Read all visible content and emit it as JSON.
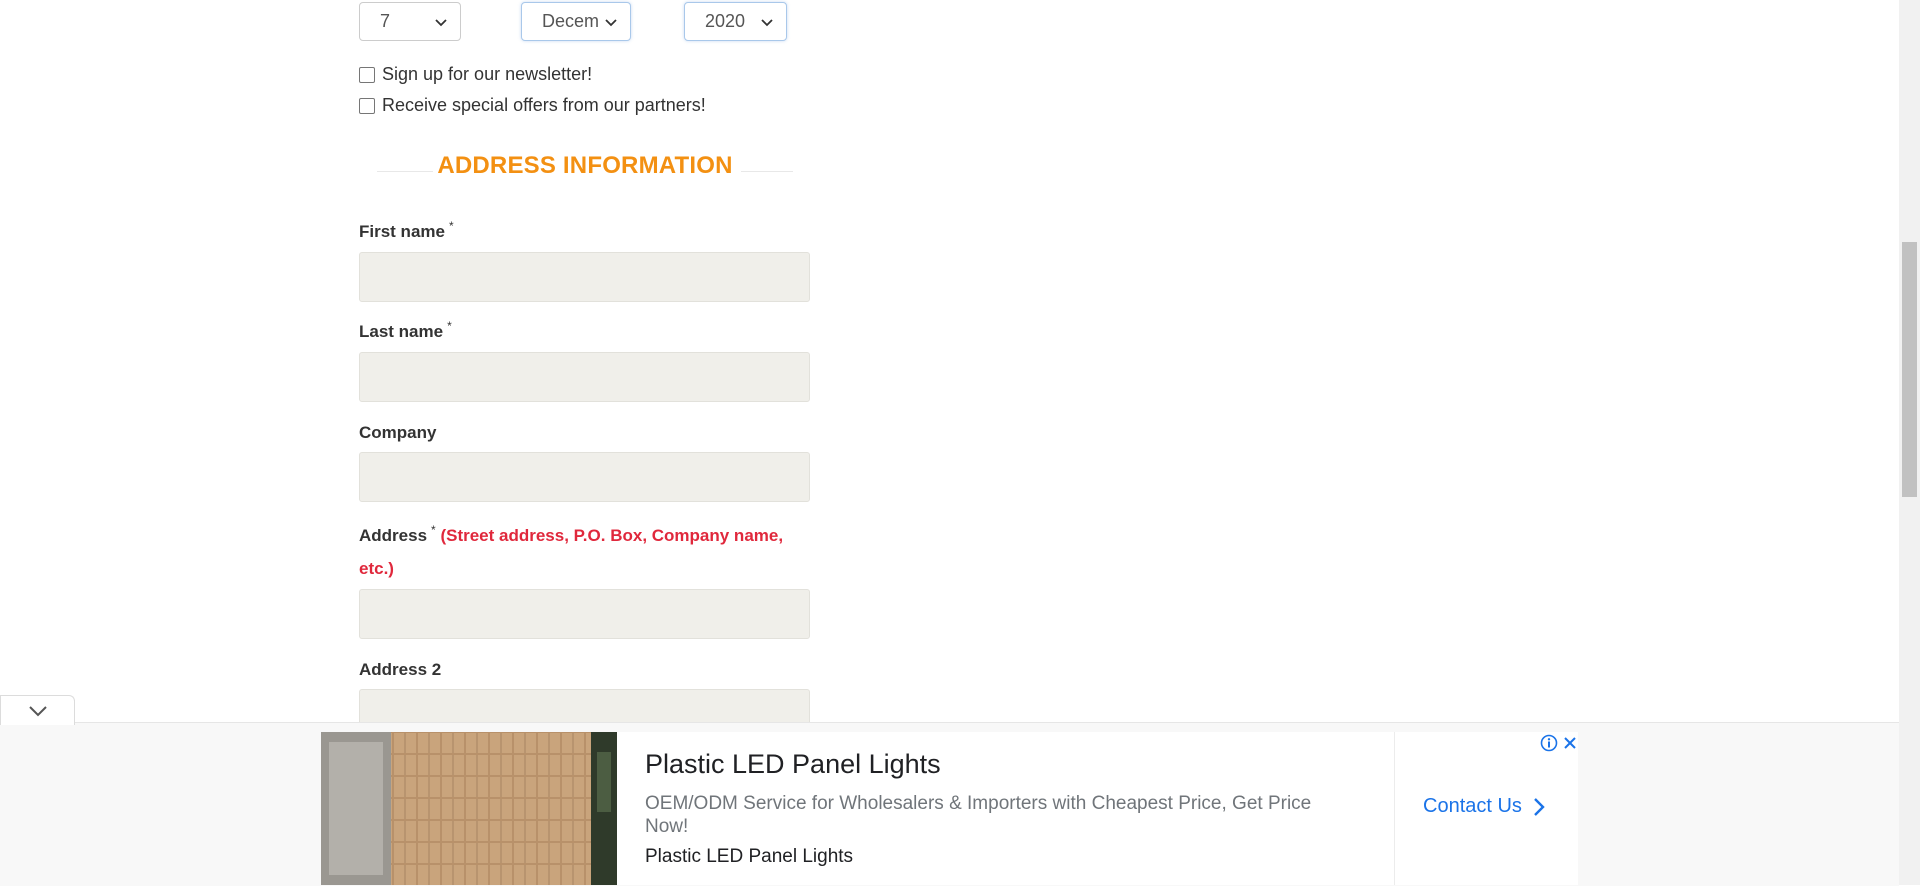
{
  "dob": {
    "day": "7",
    "month": "Decem",
    "year": "2020"
  },
  "checkboxes": {
    "newsletter": "Sign up for our newsletter!",
    "offers": "Receive special offers from our partners!"
  },
  "section": {
    "title": "ADDRESS INFORMATION"
  },
  "fields": {
    "first_name": "First name",
    "last_name": "Last name",
    "company": "Company",
    "address": "Address",
    "address_hint_1": "(Street address, P.O. Box, Company name,",
    "address_hint_2": "etc.)",
    "address2": "Address 2",
    "required_mark": "*"
  },
  "ad": {
    "title": "Plastic LED Panel Lights",
    "description": "OEM/ODM Service for Wholesalers & Importers with Cheapest Price, Get Price Now!",
    "source": "Plastic LED Panel Lights",
    "cta": "Contact Us"
  },
  "colors": {
    "section_title": "#f39012",
    "hint": "#e0283c",
    "input_bg": "#f0efea",
    "cta": "#1a73e8"
  }
}
